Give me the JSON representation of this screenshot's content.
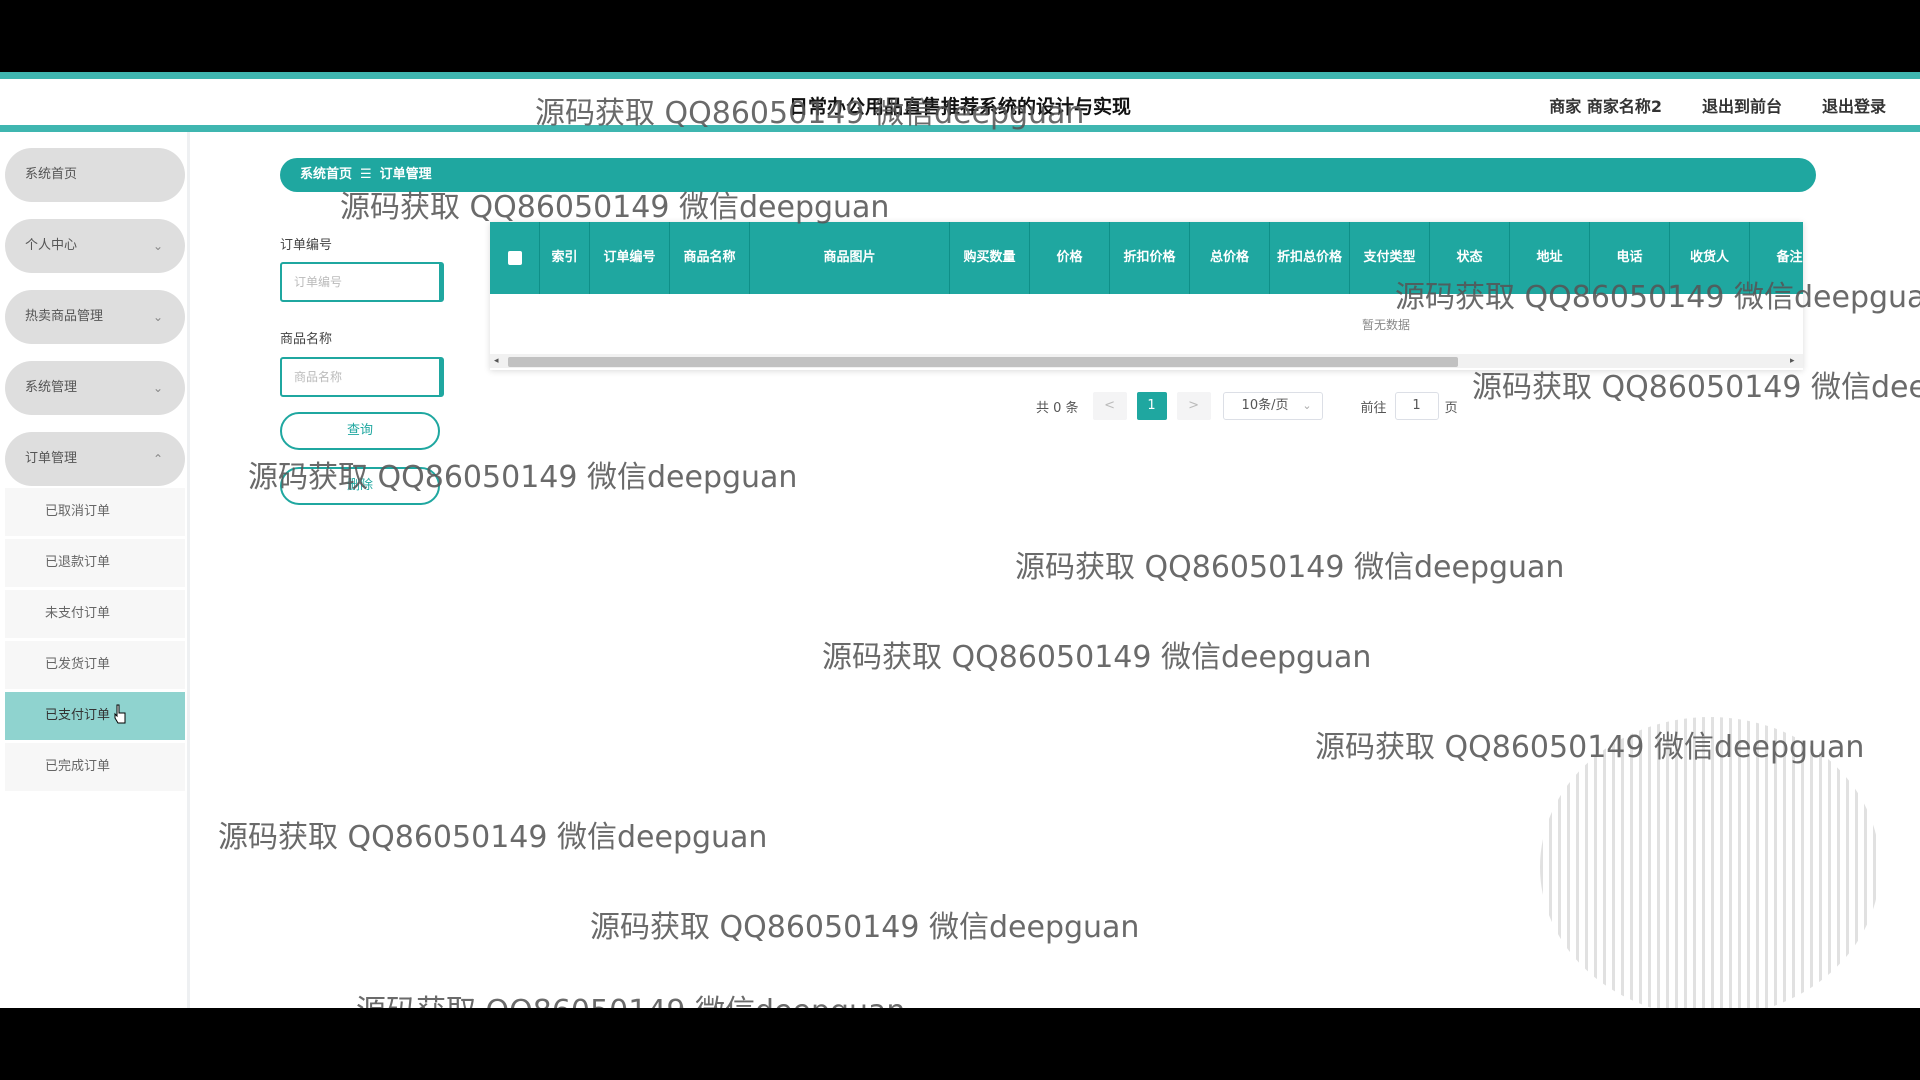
{
  "header": {
    "title": "日常办公用品直售推荐系统的设计与实现",
    "user": "商家 商家名称2",
    "to_front": "退出到前台",
    "logout": "退出登录"
  },
  "sidebar": {
    "items": [
      {
        "label": "系统首页",
        "chevron": ""
      },
      {
        "label": "个人中心",
        "chevron": "⌄"
      },
      {
        "label": "热卖商品管理",
        "chevron": "⌄"
      },
      {
        "label": "系统管理",
        "chevron": "⌄"
      },
      {
        "label": "订单管理",
        "chevron": "⌃"
      }
    ],
    "sub_items": [
      {
        "label": "已取消订单"
      },
      {
        "label": "已退款订单"
      },
      {
        "label": "未支付订单"
      },
      {
        "label": "已发货订单"
      },
      {
        "label": "已支付订单"
      },
      {
        "label": "已完成订单"
      }
    ]
  },
  "breadcrumb": {
    "home": "系统首页",
    "sep": "☰",
    "current": "订单管理"
  },
  "search": {
    "order_no_label": "订单编号",
    "order_no_placeholder": "订单编号",
    "goods_name_label": "商品名称",
    "goods_name_placeholder": "商品名称",
    "query_button": "查询",
    "delete_button": "删除"
  },
  "table": {
    "columns": [
      "索引",
      "订单编号",
      "商品名称",
      "商品图片",
      "购买数量",
      "价格",
      "折扣价格",
      "总价格",
      "折扣总价格",
      "支付类型",
      "状态",
      "地址",
      "电话",
      "收货人",
      "备注"
    ],
    "empty_text": "暂无数据"
  },
  "pager": {
    "total": "共 0 条",
    "prev": "<",
    "current_page": "1",
    "next": ">",
    "page_size": "10条/页",
    "goto_label": "前往",
    "goto_value": "1",
    "page_unit": "页"
  },
  "watermark": "源码获取 QQ86050149 微信deepguan"
}
